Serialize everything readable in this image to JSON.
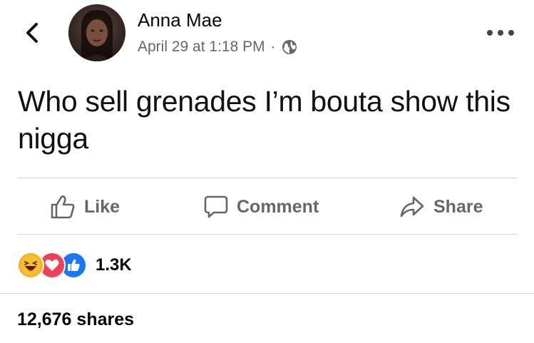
{
  "header": {
    "author_name": "Anna Mae",
    "timestamp": "April 29 at 1:18 PM",
    "separator": "·",
    "privacy_icon": "globe-icon"
  },
  "post": {
    "text": "Who sell grenades I’m bouta show this nigga"
  },
  "actions": {
    "like_label": "Like",
    "comment_label": "Comment",
    "share_label": "Share"
  },
  "engagement": {
    "reaction_icons": [
      "haha-icon",
      "love-icon",
      "like-icon"
    ],
    "reaction_count": "1.3K",
    "shares_text": "12,676 shares"
  },
  "colors": {
    "secondary_text": "#65676b",
    "like_blue": "#1877f2",
    "love_red": "#f33e58",
    "haha_yellow": "#f7b125"
  }
}
